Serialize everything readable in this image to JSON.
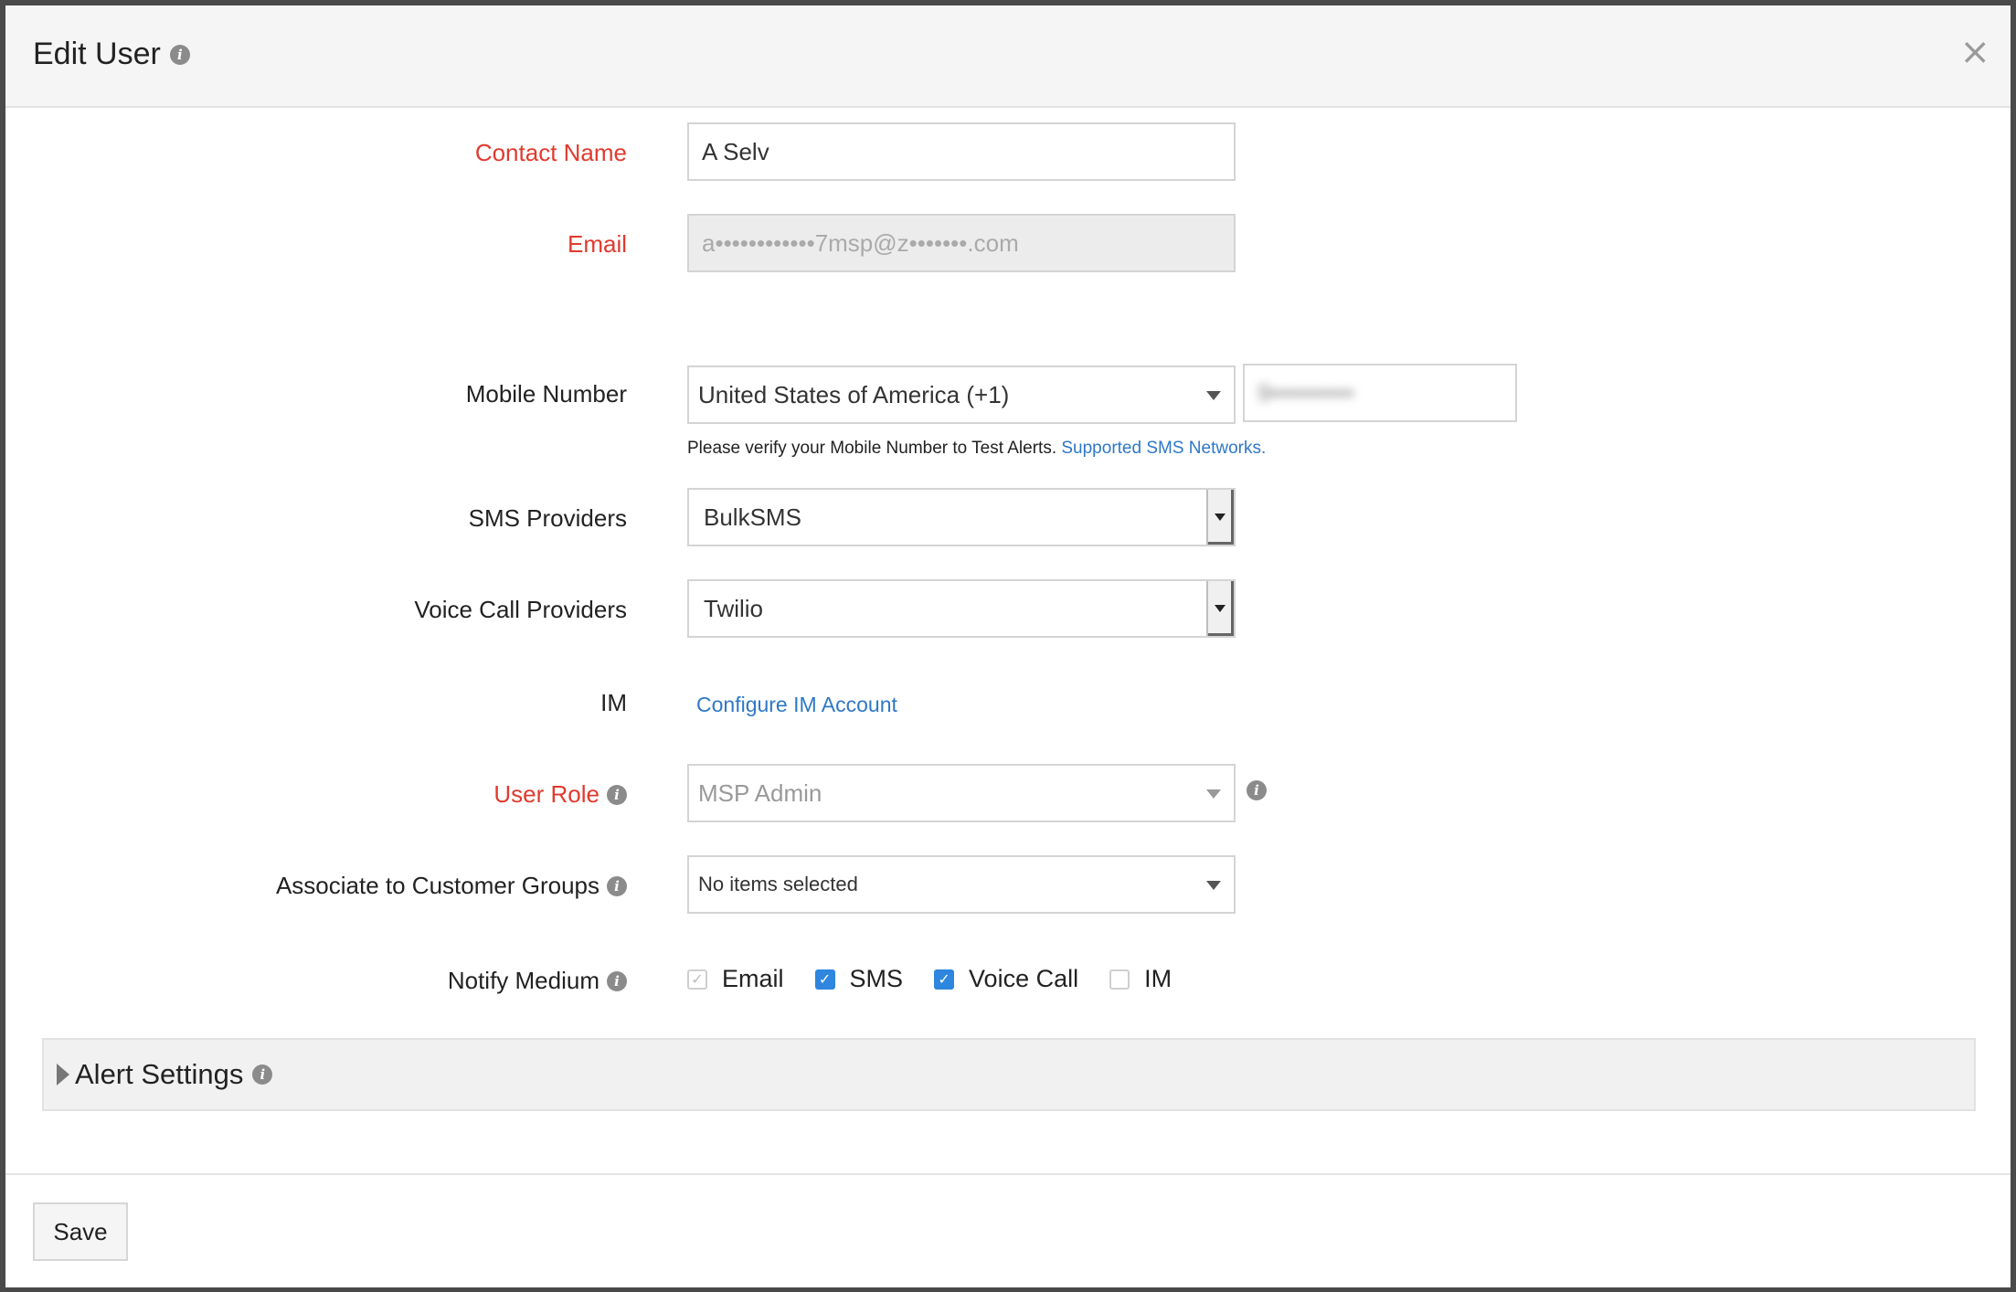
{
  "dialog": {
    "title": "Edit User",
    "close_symbol": "×"
  },
  "form": {
    "contact_name": {
      "label": "Contact Name",
      "value": "A Selv"
    },
    "email": {
      "label": "Email",
      "value": "a••••••••••••7msp@z•••••••.com"
    },
    "mobile": {
      "label": "Mobile Number",
      "country": "United States of America (+1)",
      "number": "9••••••••••",
      "help_text": "Please verify your Mobile Number to Test Alerts.",
      "help_link": "Supported SMS Networks."
    },
    "sms_providers": {
      "label": "SMS Providers",
      "value": "BulkSMS"
    },
    "voice_call_providers": {
      "label": "Voice Call Providers",
      "value": "Twilio"
    },
    "im": {
      "label": "IM",
      "link": "Configure IM Account"
    },
    "user_role": {
      "label": "User Role",
      "value": "MSP Admin"
    },
    "customer_groups": {
      "label": "Associate to Customer Groups",
      "value": "No items selected"
    },
    "notify_medium": {
      "label": "Notify Medium",
      "options": [
        {
          "label": "Email",
          "checked": true,
          "disabled": true
        },
        {
          "label": "SMS",
          "checked": true,
          "disabled": false
        },
        {
          "label": "Voice Call",
          "checked": true,
          "disabled": false
        },
        {
          "label": "IM",
          "checked": false,
          "disabled": false
        }
      ]
    }
  },
  "alert_settings": {
    "label": "Alert Settings"
  },
  "footer": {
    "save_label": "Save"
  },
  "icons": {
    "info": "i",
    "check": "✓"
  },
  "colors": {
    "required": "#e03a2e",
    "link": "#2e78c7",
    "checkbox": "#2e86de"
  }
}
